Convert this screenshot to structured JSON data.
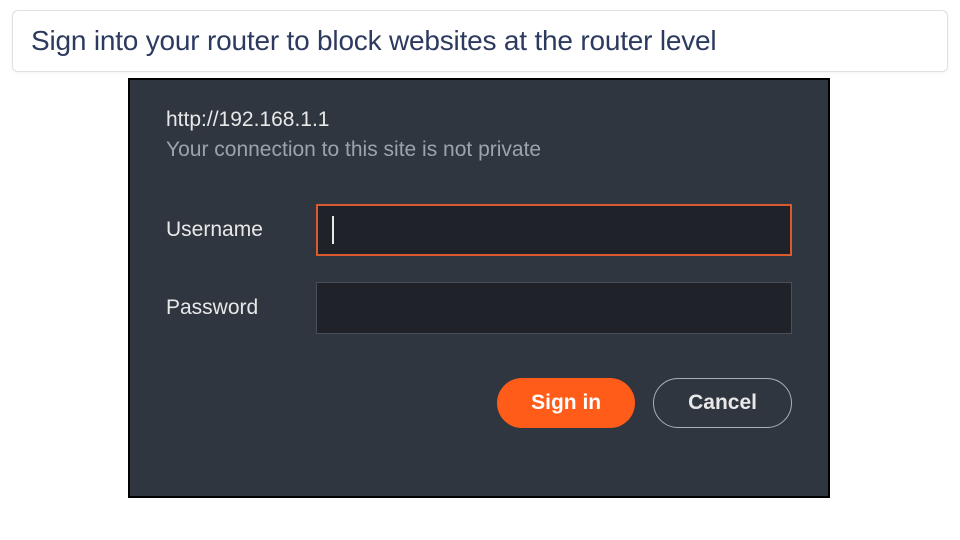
{
  "caption": {
    "text": "Sign into your router to block websites at the router level"
  },
  "dialog": {
    "url": "http://192.168.1.1",
    "warning": "Your connection to this site is not private",
    "username_label": "Username",
    "username_value": "",
    "password_label": "Password",
    "password_value": "",
    "signin_label": "Sign in",
    "cancel_label": "Cancel"
  },
  "colors": {
    "dialog_bg": "#2f3640",
    "accent": "#ff5c1a",
    "focus_border": "#d85a2e"
  }
}
